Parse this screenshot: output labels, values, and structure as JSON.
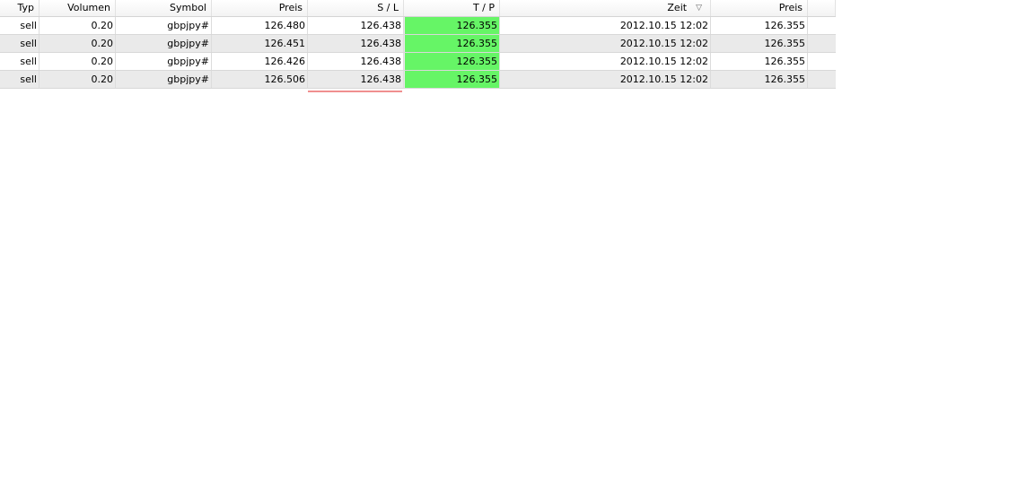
{
  "colors": {
    "tp_highlight": "#66f566",
    "alt_row": "#eaeaea",
    "sl_marker": "#f08f8f"
  },
  "table": {
    "columns": [
      "Typ",
      "Volumen",
      "Symbol",
      "Preis",
      "S / L",
      "T / P",
      "Zeit",
      "Preis"
    ],
    "sort_icon": "sort-descending-icon",
    "sort_glyph": "▽",
    "rows": [
      {
        "typ": "sell",
        "volumen": "0.20",
        "symbol": "gbpjpy#",
        "preis": "126.480",
        "sl": "126.438",
        "tp": "126.355",
        "zeit": "2012.10.15 12:02",
        "preis2": "126.355"
      },
      {
        "typ": "sell",
        "volumen": "0.20",
        "symbol": "gbpjpy#",
        "preis": "126.451",
        "sl": "126.438",
        "tp": "126.355",
        "zeit": "2012.10.15 12:02",
        "preis2": "126.355"
      },
      {
        "typ": "sell",
        "volumen": "0.20",
        "symbol": "gbpjpy#",
        "preis": "126.426",
        "sl": "126.438",
        "tp": "126.355",
        "zeit": "2012.10.15 12:02",
        "preis2": "126.355"
      },
      {
        "typ": "sell",
        "volumen": "0.20",
        "symbol": "gbpjpy#",
        "preis": "126.506",
        "sl": "126.438",
        "tp": "126.355",
        "zeit": "2012.10.15 12:02",
        "preis2": "126.355"
      }
    ]
  }
}
